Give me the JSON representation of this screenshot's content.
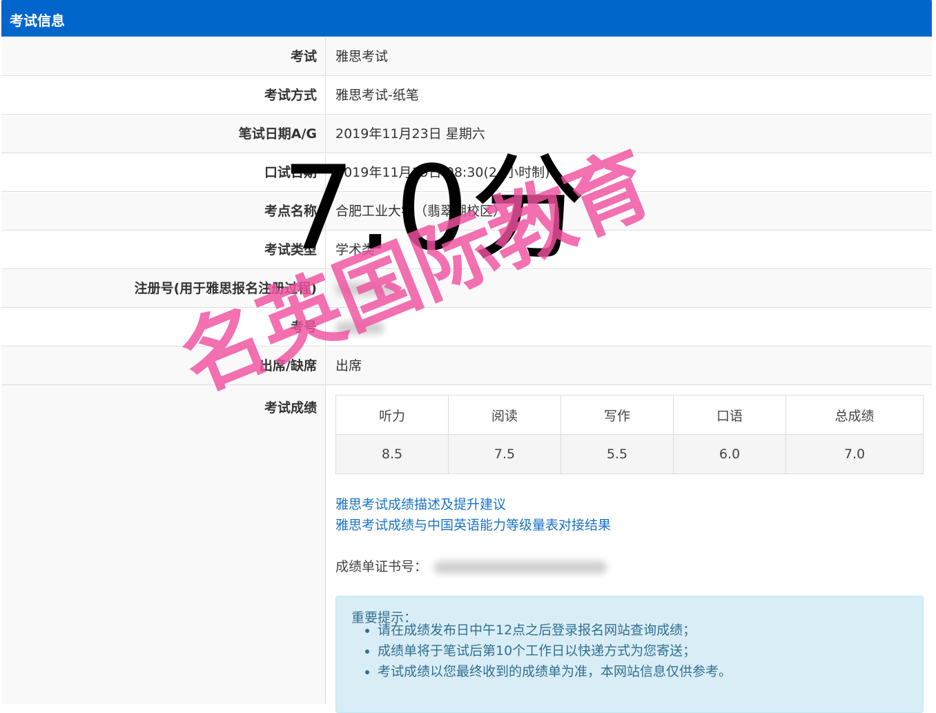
{
  "header": {
    "title": "考试信息"
  },
  "rows": [
    {
      "label": "考试",
      "value": "雅思考试"
    },
    {
      "label": "考试方式",
      "value": "雅思考试-纸笔"
    },
    {
      "label": "笔试日期A/G",
      "value": "2019年11月23日 星期六"
    },
    {
      "label": "口试日期",
      "value": "2019年11月19日 08:30(24小时制)"
    },
    {
      "label": "考点名称",
      "value": "合肥工业大学（翡翠湖校区）"
    },
    {
      "label": "考试类型",
      "value": "学术类"
    },
    {
      "label": "注册号(用于雅思报名注册过程)",
      "value": ""
    },
    {
      "label": "考号",
      "value": ""
    },
    {
      "label": "出席/缺席",
      "value": "出席"
    }
  ],
  "scores": {
    "label": "考试成绩",
    "headers": [
      "听力",
      "阅读",
      "写作",
      "口语",
      "总成绩"
    ],
    "values": [
      "8.5",
      "7.5",
      "5.5",
      "6.0",
      "7.0"
    ]
  },
  "links": [
    "雅思考试成绩描述及提升建议",
    "雅思考试成绩与中国英语能力等级量表对接结果"
  ],
  "certificate": {
    "label": "成绩单证书号："
  },
  "notice": {
    "title": "重要提示：",
    "items": [
      "请在成绩发布日中午12点之后登录报名网站查询成绩；",
      "成绩单将于笔试后第10个工作日以快递方式为您寄送；",
      "考试成绩以您最终收到的成绩单为准，本网站信息仅供参考。"
    ]
  },
  "overlay": {
    "score_text": "7.0分",
    "brand_text": "名英国际教育"
  }
}
